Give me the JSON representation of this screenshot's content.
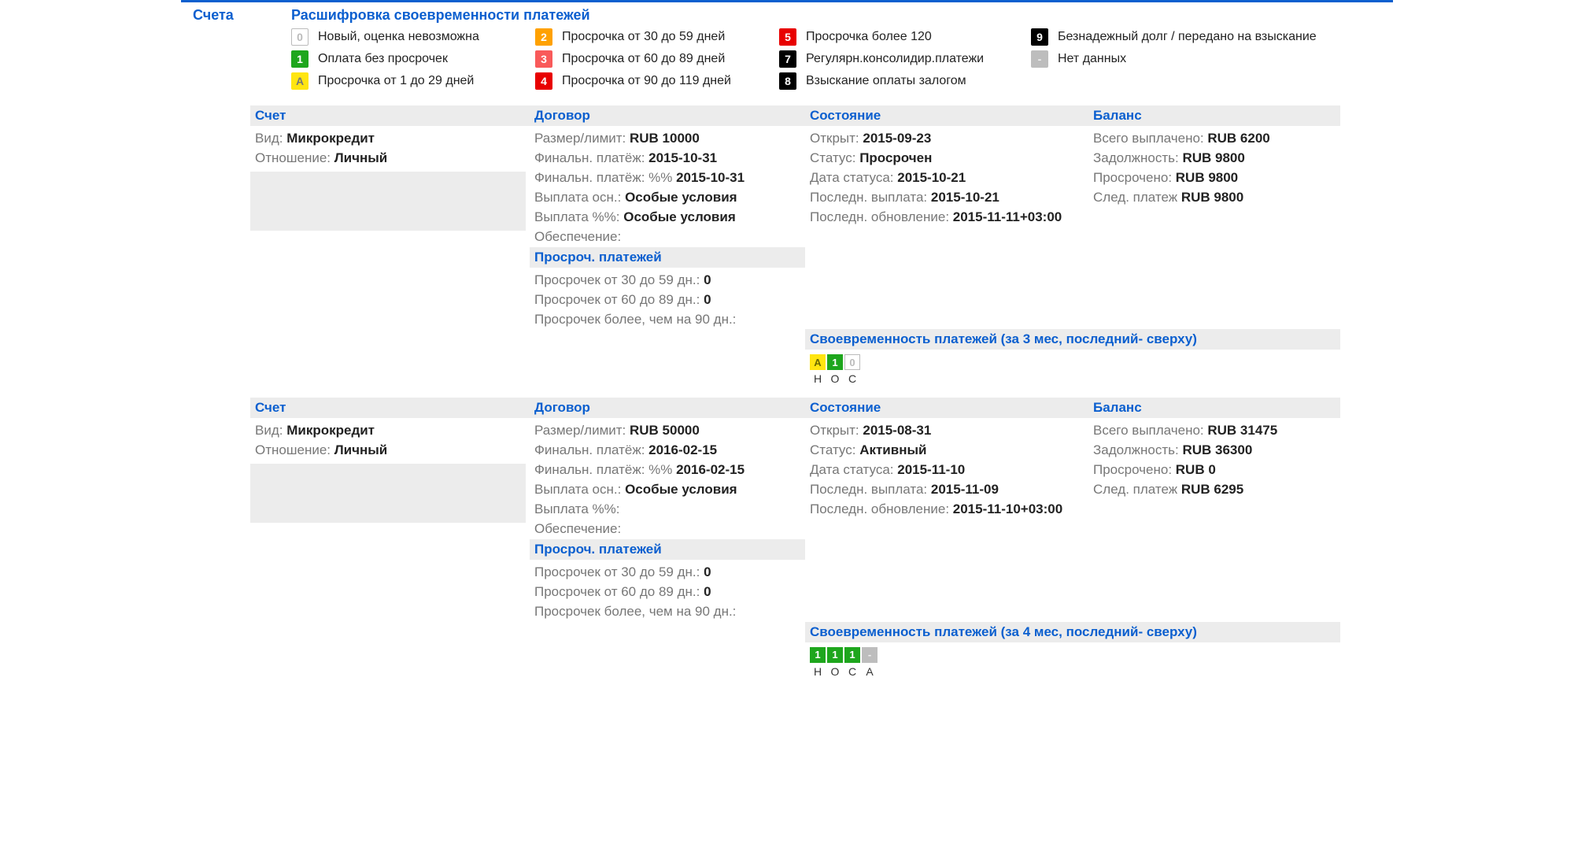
{
  "title": "Счета",
  "legend": {
    "title": "Расшифровка своевременности платежей",
    "rows": [
      [
        {
          "k": "0",
          "c": "c0",
          "t": "Новый, оценка невозможна"
        },
        {
          "k": "2",
          "c": "c2",
          "t": "Просрочка от 30 до 59 дней"
        },
        {
          "k": "5",
          "c": "c5",
          "t": "Просрочка более 120"
        },
        {
          "k": "9",
          "c": "c9",
          "t": "Безнадежный долг / передано на взыскание"
        }
      ],
      [
        {
          "k": "1",
          "c": "c1",
          "t": "Оплата без просрочек"
        },
        {
          "k": "3",
          "c": "c3",
          "t": "Просрочка от 60 до 89 дней"
        },
        {
          "k": "7",
          "c": "c7",
          "t": "Регулярн.консолидир.платежи"
        },
        {
          "k": "-",
          "c": "c-",
          "t": "Нет данных"
        }
      ],
      [
        {
          "k": "A",
          "c": "cA",
          "t": "Просрочка от 1 до 29 дней"
        },
        {
          "k": "4",
          "c": "c4",
          "t": "Просрочка от 90 до 119 дней"
        },
        {
          "k": "8",
          "c": "c8",
          "t": "Взыскание оплаты залогом"
        }
      ]
    ]
  },
  "labels": {
    "account": "Счет",
    "contract": "Договор",
    "state": "Состояние",
    "balance": "Баланс",
    "kind": "Вид:",
    "relation": "Отношение:",
    "limit": "Размер/лимит:",
    "final": "Финальн. платёж:",
    "finalPct": "Финальн. платёж: %%",
    "payMain": "Выплата осн.:",
    "payPct": "Выплата %%:",
    "security": "Обеспечение:",
    "late": "Просроч. платежей",
    "late30": "Просрочек от 30 до 59 дн.:",
    "late60": "Просрочек от 60 до 89 дн.:",
    "late90": "Просрочек более, чем на 90 дн.:",
    "opened": "Открыт:",
    "status": "Статус:",
    "statusDate": "Дата статуса:",
    "lastPay": "Последн. выплата:",
    "lastUpd": "Последн. обновление:",
    "paid": "Всего выплачено:",
    "debt": "Задолжность:",
    "overdue": "Просрочено:",
    "next": "След. платеж"
  },
  "accounts": [
    {
      "kind": "Микрокредит",
      "relation": "Личный",
      "limit": "RUB 10000",
      "final": "2015-10-31",
      "finalPct": "2015-10-31",
      "payMain": "Особые условия",
      "payPct": "Особые условия",
      "security": "",
      "late30": "0",
      "late60": "0",
      "late90": "",
      "opened": "2015-09-23",
      "status": "Просрочен",
      "statusDate": "2015-10-21",
      "lastPay": "2015-10-21",
      "lastUpd": "2015-11-11+03:00",
      "paid": "RUB 6200",
      "debt": "RUB 9800",
      "overdue": "RUB 9800",
      "next": "RUB 9800",
      "tlTitle": "Своевременность платежей (за 3 мес, последний- сверху)",
      "tl": [
        {
          "k": "A",
          "c": "cA"
        },
        {
          "k": "1",
          "c": "c1"
        },
        {
          "k": "0",
          "c": "c0"
        }
      ],
      "months": [
        "Н",
        "О",
        "С"
      ]
    },
    {
      "kind": "Микрокредит",
      "relation": "Личный",
      "limit": "RUB 50000",
      "final": "2016-02-15",
      "finalPct": "2016-02-15",
      "payMain": "Особые условия",
      "payPct": "",
      "security": "",
      "late30": "0",
      "late60": "0",
      "late90": "",
      "opened": "2015-08-31",
      "status": "Активный",
      "statusDate": "2015-11-10",
      "lastPay": "2015-11-09",
      "lastUpd": "2015-11-10+03:00",
      "paid": "RUB 31475",
      "debt": "RUB 36300",
      "overdue": "RUB 0",
      "next": "RUB 6295",
      "tlTitle": "Своевременность платежей (за 4 мес, последний- сверху)",
      "tl": [
        {
          "k": "1",
          "c": "c1"
        },
        {
          "k": "1",
          "c": "c1"
        },
        {
          "k": "1",
          "c": "c1"
        },
        {
          "k": "-",
          "c": "cd"
        }
      ],
      "months": [
        "Н",
        "О",
        "С",
        "А"
      ]
    }
  ]
}
